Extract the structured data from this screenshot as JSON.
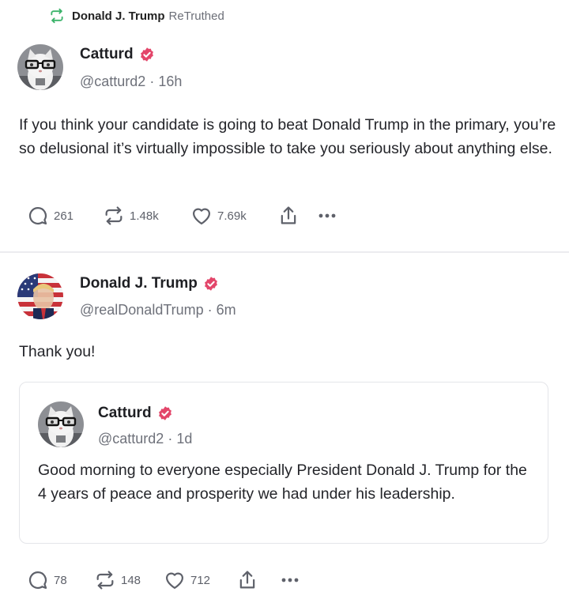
{
  "retruth": {
    "name": "Donald J. Trump",
    "label": "ReTruthed",
    "icon": "retruth-icon"
  },
  "post1": {
    "author": {
      "name": "Catturd",
      "handle": "@catturd2",
      "age": "16h",
      "avatar": "cat-avatar"
    },
    "text": "If you think your candidate is going to beat Donald Trump in the primary, you’re so delusional it’s virtually impossible to take you seriously about anything else.",
    "stats": {
      "replies": "261",
      "retruths": "1.48k",
      "likes": "7.69k"
    }
  },
  "post2": {
    "author": {
      "name": "Donald J. Trump",
      "handle": "@realDonaldTrump",
      "age": "6m",
      "avatar": "flag-portrait-avatar"
    },
    "text": "Thank you!",
    "quote": {
      "author": {
        "name": "Catturd",
        "handle": "@catturd2",
        "age": "1d",
        "avatar": "cat-avatar"
      },
      "text": "Good morning to everyone especially President Donald J. Trump for the 4 years of peace and prosperity we had under his leadership."
    },
    "stats": {
      "replies": "78",
      "retruths": "148",
      "likes": "712"
    }
  },
  "colors": {
    "verified": "#e3466a",
    "retruth_icon": "#3bb36a",
    "icon_gray": "#5e616a"
  }
}
